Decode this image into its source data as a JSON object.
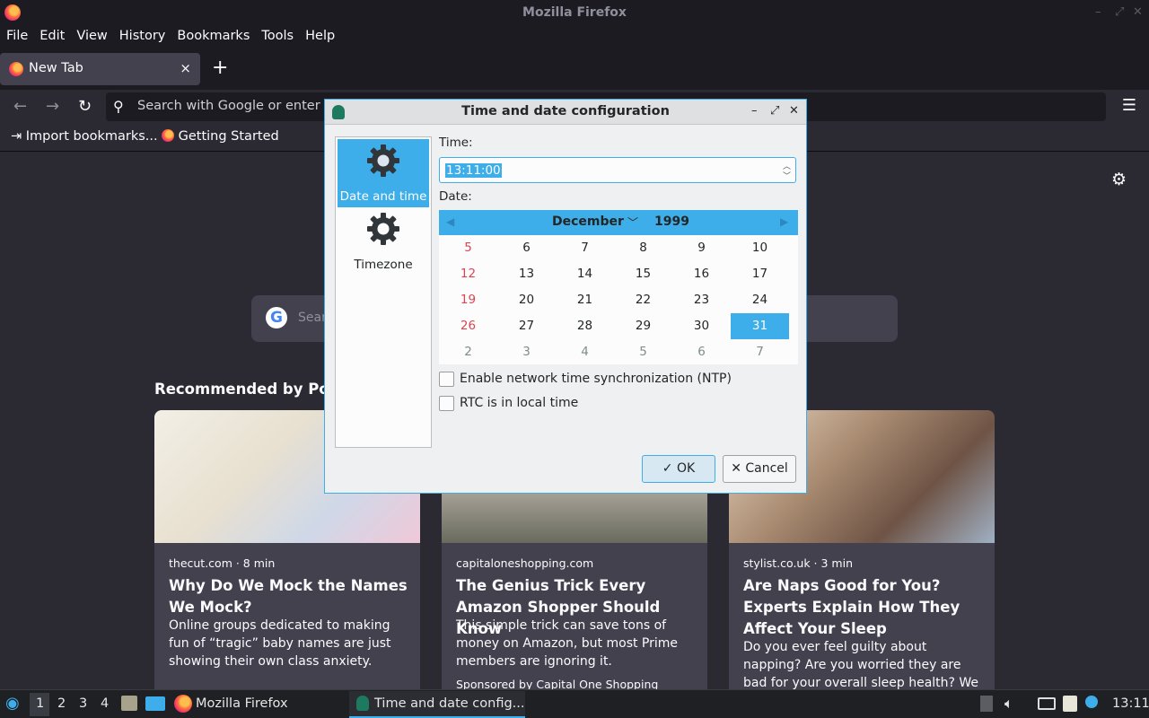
{
  "window": {
    "title": "Mozilla Firefox"
  },
  "menu": [
    "File",
    "Edit",
    "View",
    "History",
    "Bookmarks",
    "Tools",
    "Help"
  ],
  "tab": {
    "label": "New Tab",
    "close": "×",
    "new": "+"
  },
  "nav": {
    "url_placeholder": "Search with Google or enter a"
  },
  "bookmarks": [
    {
      "label": "Import bookmarks...",
      "icon": "import-icon"
    },
    {
      "label": "Getting Started",
      "icon": "firefox-icon"
    }
  ],
  "newtab": {
    "search_placeholder": "Sear",
    "recommended_heading": "Recommended by Pocke",
    "cards": [
      {
        "source": "thecut.com · 8 min",
        "title": "Why Do We Mock the Names We Mock?",
        "desc": "Online groups dedicated to making fun of “tragic” baby names are just showing their own class anxiety."
      },
      {
        "source": "capitaloneshopping.com",
        "title": "The Genius Trick Every Amazon Shopper Should Know",
        "desc": "This simple trick can save tons of money on Amazon, but most Prime members are ignoring it.",
        "sponsor": "Sponsored by Capital One Shopping"
      },
      {
        "source": "stylist.co.uk · 3 min",
        "title": "Are Naps Good for You? Experts Explain How They Affect Your Sleep",
        "desc": "Do you ever feel guilty about napping? Are you worried they are bad for your overall sleep health? We asked sleep…"
      }
    ]
  },
  "dialog": {
    "title": "Time and date configuration",
    "sidebar": [
      "Date and time",
      "Timezone"
    ],
    "time_label": "Time:",
    "time_value": "13:11:00",
    "date_label": "Date:",
    "month": "December",
    "year": "1999",
    "weeks": [
      [
        "5",
        "6",
        "7",
        "8",
        "9",
        "10"
      ],
      [
        "12",
        "13",
        "14",
        "15",
        "16",
        "17"
      ],
      [
        "19",
        "20",
        "21",
        "22",
        "23",
        "24"
      ],
      [
        "26",
        "27",
        "28",
        "29",
        "30",
        "31"
      ],
      [
        "2",
        "3",
        "4",
        "5",
        "6",
        "7"
      ]
    ],
    "selected_day": "31",
    "ntp_label": "Enable network time synchronization (NTP)",
    "rtc_label": "RTC is in local time",
    "ok_label": "OK",
    "cancel_label": "Cancel"
  },
  "taskbar": {
    "workspaces": [
      "1",
      "2",
      "3",
      "4"
    ],
    "firefox_label": "Mozilla Firefox",
    "dialog_label": "Time and date config...",
    "clock": "13:11"
  }
}
